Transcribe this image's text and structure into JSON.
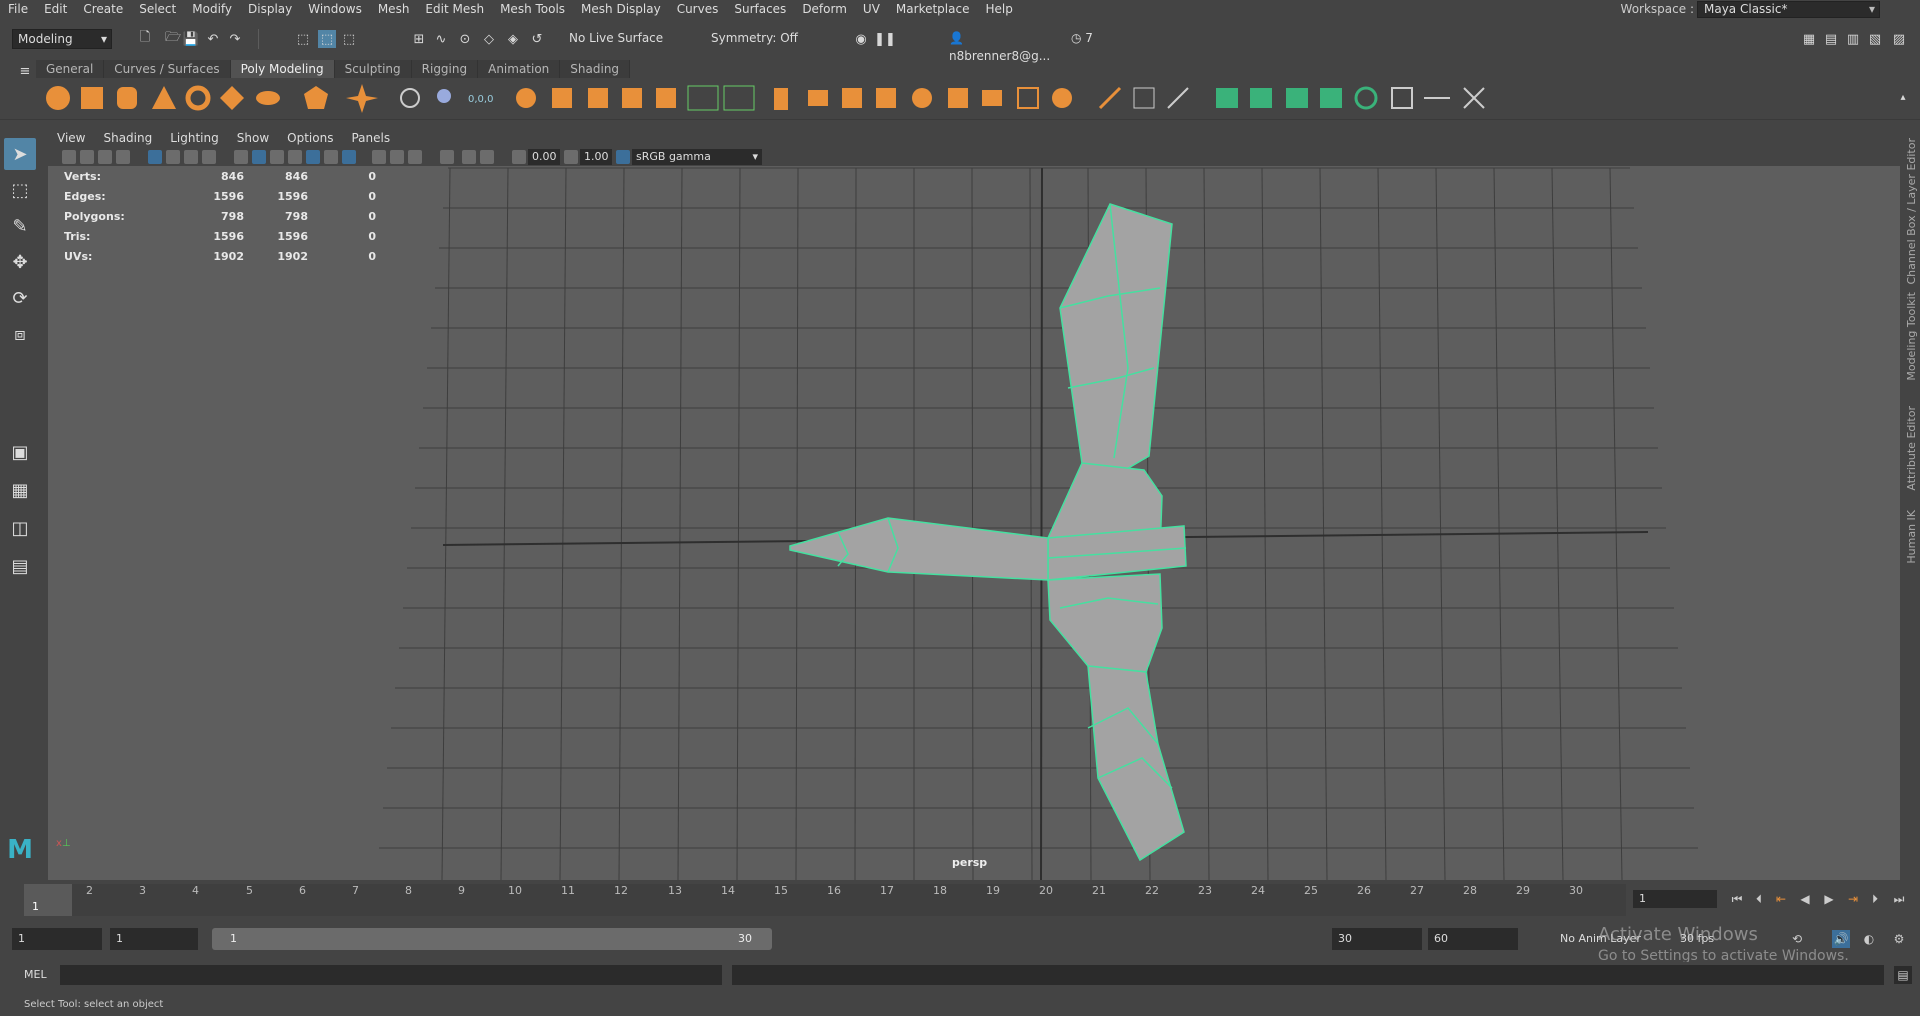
{
  "menu": [
    "File",
    "Edit",
    "Create",
    "Select",
    "Modify",
    "Display",
    "Windows",
    "Mesh",
    "Edit Mesh",
    "Mesh Tools",
    "Mesh Display",
    "Curves",
    "Surfaces",
    "Deform",
    "UV",
    "Marketplace",
    "Help"
  ],
  "workspace": {
    "label": "Workspace :",
    "value": "Maya Classic*"
  },
  "statusline": {
    "mode": "Modeling",
    "live_surface": "No Live Surface",
    "symmetry": "Symmetry: Off",
    "user": "n8brenner8@g...",
    "notifications": "7"
  },
  "shelf_tabs": [
    "General",
    "Curves / Surfaces",
    "Poly Modeling",
    "Sculpting",
    "Rigging",
    "Animation",
    "Shading"
  ],
  "shelf_active_tab": "Poly Modeling",
  "panel_menu": [
    "View",
    "Shading",
    "Lighting",
    "Show",
    "Options",
    "Panels"
  ],
  "panel_toolbar": {
    "exposure": "0.00",
    "gamma": "1.00",
    "color_space": "sRGB gamma"
  },
  "hud": [
    {
      "label": "Verts:",
      "v1": "846",
      "v2": "846",
      "v3": "0"
    },
    {
      "label": "Edges:",
      "v1": "1596",
      "v2": "1596",
      "v3": "0"
    },
    {
      "label": "Polygons:",
      "v1": "798",
      "v2": "798",
      "v3": "0"
    },
    {
      "label": "Tris:",
      "v1": "1596",
      "v2": "1596",
      "v3": "0"
    },
    {
      "label": "UVs:",
      "v1": "1902",
      "v2": "1902",
      "v3": "0"
    }
  ],
  "viewport": {
    "camera": "persp",
    "mesh_color": "#45e0a0",
    "grid_color": "#3e3e3e",
    "bg_color": "#5e5e5e"
  },
  "right_tabs": [
    "Channel Box / Layer Editor",
    "Modeling Toolkit",
    "Attribute Editor",
    "Human IK"
  ],
  "timeline": {
    "ticks": [
      "1",
      "2",
      "3",
      "4",
      "5",
      "6",
      "7",
      "8",
      "9",
      "10",
      "11",
      "12",
      "13",
      "14",
      "15",
      "16",
      "17",
      "18",
      "19",
      "20",
      "21",
      "22",
      "23",
      "24",
      "25",
      "26",
      "27",
      "28",
      "29",
      "30"
    ],
    "current_marker": "1",
    "current_frame": "1"
  },
  "range": {
    "start": "1",
    "playback_start": "1",
    "bar_start": "1",
    "bar_end": "30",
    "playback_end": "30",
    "end": "60",
    "anim_layer": "No Anim Layer",
    "fps": "30 fps"
  },
  "cmdline": {
    "label": "MEL"
  },
  "helpline": {
    "text": "Select Tool: select an object"
  },
  "watermark": {
    "line1": "Activate Windows",
    "line2": "Go to Settings to activate Windows."
  },
  "accent_color": "#5285a6"
}
